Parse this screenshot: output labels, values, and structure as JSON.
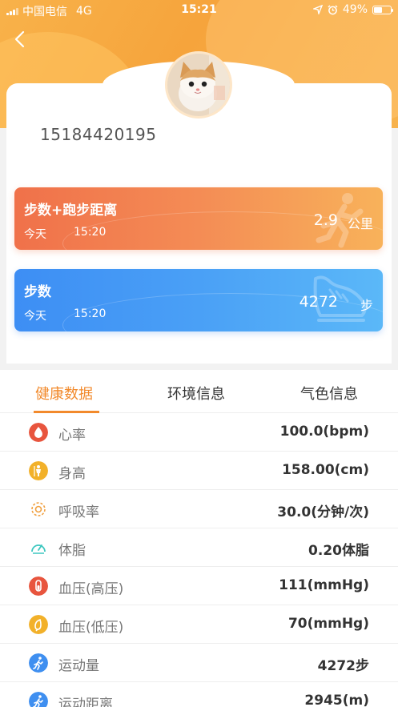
{
  "status_bar": {
    "carrier": "中国电信",
    "network": "4G",
    "time": "15:21",
    "battery": "49%",
    "battery_level": 0.49
  },
  "profile": {
    "phone": "15184420195"
  },
  "cards": [
    {
      "title": "步数+跑步距离",
      "date": "今天",
      "time": "15:20",
      "value": "2.9",
      "unit": "公里",
      "icon": "runner-icon"
    },
    {
      "title": "步数",
      "date": "今天",
      "time": "15:20",
      "value": "4272",
      "unit": "步",
      "icon": "shoe-icon"
    }
  ],
  "tabs": [
    {
      "label": "健康数据",
      "active": true
    },
    {
      "label": "环境信息",
      "active": false
    },
    {
      "label": "气色信息",
      "active": false
    }
  ],
  "metrics": [
    {
      "name": "心率",
      "value": "100.0(bpm)",
      "icon": "heart-rate-icon",
      "color": "#e8553e"
    },
    {
      "name": "身高",
      "value": "158.00(cm)",
      "icon": "height-icon",
      "color": "#f2b12a"
    },
    {
      "name": "呼吸率",
      "value": "30.0(分钟/次)",
      "icon": "breathing-icon",
      "color": "#f0a040"
    },
    {
      "name": "体脂",
      "value": "0.20体脂",
      "icon": "body-fat-icon",
      "color": "#3ec7c0"
    },
    {
      "name": "血压(高压)",
      "value": "111(mmHg)",
      "icon": "blood-pressure-high-icon",
      "color": "#e8553e"
    },
    {
      "name": "血压(低压)",
      "value": "70(mmHg)",
      "icon": "blood-pressure-low-icon",
      "color": "#f2b12a"
    },
    {
      "name": "运动量",
      "value": "4272步",
      "icon": "exercise-icon",
      "color": "#3f8ff0"
    },
    {
      "name": "运动距离",
      "value": "2945(m)",
      "icon": "distance-icon",
      "color": "#3f8ff0"
    }
  ],
  "colors": {
    "header_orange": "#f6a43c",
    "tab_active": "#f28a2c",
    "card_orange": "#f0714a",
    "card_blue": "#3d8ef4"
  }
}
